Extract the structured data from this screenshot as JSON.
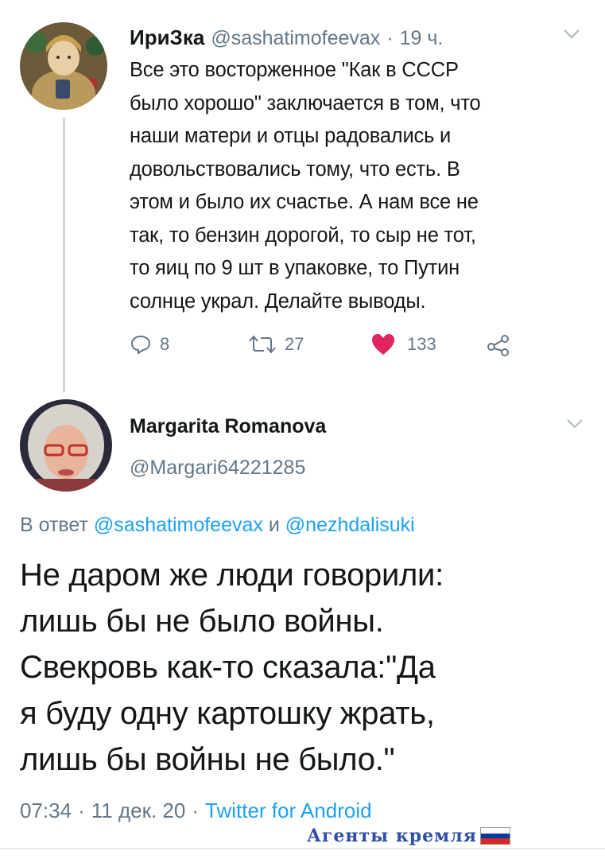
{
  "tweet1": {
    "name": "ИриЗка",
    "handle": "@sashatimofeevax",
    "dot": "·",
    "time": "19 ч.",
    "text_lines": [
      "Все это восторженное \"Как в СССР",
      "было хорошо\" заключается в том, что",
      "наши матери и отцы радовались и",
      "довольствовались тому, что есть. В",
      "этом и было их счастье. А нам все не",
      "так, то бензин дорогой, то сыр не тот,",
      "то яиц по 9 шт в упаковке, то Путин",
      "солнце украл. Делайте выводы."
    ],
    "replies": "8",
    "retweets": "27",
    "likes": "133",
    "like_color": "#e0245e"
  },
  "tweet2": {
    "name": "Margarita Romanova",
    "handle": "@Margari64221285",
    "reply_prefix": "В ответ",
    "reply_user1": "@sashatimofeevax",
    "reply_and": "и",
    "reply_user2": "@nezhdalisuki",
    "text_lines": [
      "Не даром же люди говорили:",
      "лишь бы не было войны.",
      "Свекровь как-то сказала:\"Да",
      "я буду одну картошку жрать,",
      "лишь бы войны не было.\""
    ],
    "time": "07:34",
    "dot": "·",
    "date": "11 дек. 20",
    "source": "Twitter for Android"
  },
  "watermark": "Агенты кремля",
  "colors": {
    "accent": "#1da1f2",
    "secondary_text": "#657786",
    "like": "#e0245e",
    "flag_white": "#ffffff",
    "flag_blue": "#0039a6",
    "flag_red": "#d52b1e"
  }
}
